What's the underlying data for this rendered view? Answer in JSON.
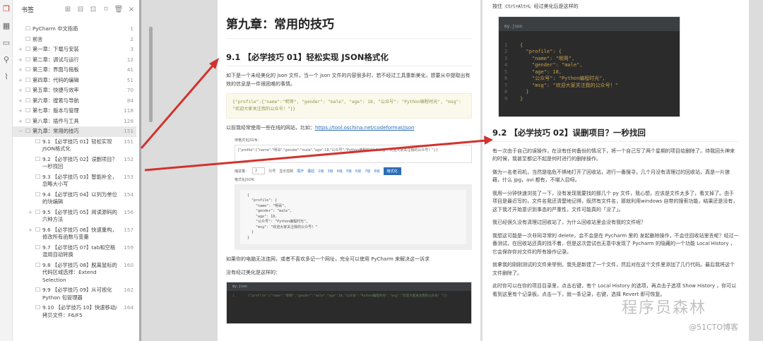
{
  "sidebar_icons": [
    "bookmark-icon",
    "thumbnails-icon",
    "comment-icon",
    "search-icon",
    "attachment-icon"
  ],
  "panel": {
    "title": "书签",
    "close": "×",
    "items": [
      {
        "label": "PyCharm 中文指南",
        "page": "1",
        "exp": ""
      },
      {
        "label": "前言",
        "page": "2",
        "exp": ""
      },
      {
        "label": "第一章：下载与安装",
        "page": "3",
        "exp": "+"
      },
      {
        "label": "第二章：调试与运行",
        "page": "12",
        "exp": "+"
      },
      {
        "label": "第三章：界面与拖板",
        "page": "41",
        "exp": "+"
      },
      {
        "label": "第四章：代码的编辑",
        "page": "51",
        "exp": "+"
      },
      {
        "label": "第五章：快捷与效率",
        "page": "70",
        "exp": "+"
      },
      {
        "label": "第六章：搜索与导航",
        "page": "84",
        "exp": "+"
      },
      {
        "label": "第七章：版本与管理",
        "page": "118",
        "exp": "+"
      },
      {
        "label": "第八章：插件与工具",
        "page": "128",
        "exp": "+"
      },
      {
        "label": "第九章：常用的技巧",
        "page": "151",
        "exp": "−"
      }
    ],
    "subitems": [
      {
        "label": "9.1 【必学技巧 01】轻松实现 JSON格式化",
        "page": "151",
        "exp": ""
      },
      {
        "label": "9.2 【必学技巧 02】误删项目？一秒找回",
        "page": "152",
        "exp": ""
      },
      {
        "label": "9.3 【必学技巧 03】智能补全，忽略大小写",
        "page": "153",
        "exp": ""
      },
      {
        "label": "9.4 【必学技巧 04】以列为单位的块编辑",
        "page": "154",
        "exp": ""
      },
      {
        "label": "9.5 【必学技巧 05】阅读源码的六种方法",
        "page": "156",
        "exp": "+"
      },
      {
        "label": "9.6 【必学技巧 06】快速重构，修改所有函数与变量",
        "page": "157",
        "exp": "+"
      },
      {
        "label": "9.7 【必学技巧 07】tab和空格混用自动转换",
        "page": "159",
        "exp": ""
      },
      {
        "label": "9.8 【必学技巧 08】脱离鼠标的代码区域选择：Extend Selection",
        "page": "160",
        "exp": ""
      },
      {
        "label": "9.9 【必学技巧 09】从可视化 Python 包管理器",
        "page": "162",
        "exp": ""
      },
      {
        "label": "9.10 【必学技巧 10】快速移动/拷贝文件：F6/F5",
        "page": "164",
        "exp": ""
      }
    ]
  },
  "page1": {
    "chapter": "第九章：常用的技巧",
    "h91": "9.1 【必学技巧 01】轻松实现 JSON格式化",
    "p1": "如下是一个未经美化的 json 文件，当一个 json 文件的内容很多时，若不经过工具重新美化，想要从中提取出有效的信息是一件很困难的事情。",
    "code": "{\"profile\":{\"name\":\"明哥\", \"gender\": \"male\", \"age\": 18, \"公众号\": \"Python编程时光\", \"msg\": \"欢迎大家关注我的公众号！\"}}",
    "p2": "以前我经常使用一些在线的网站，比如：",
    "link": "https://tool.oschina.net/codeformat/json",
    "tool": {
      "input_label": "待格式化JSON：",
      "input": "{\"profile\":{\"name\":\"明哥\",\"gender\":\"male\",\"age\":18,\"公众号\":\"Python编程时光\",\"msg\":\"欢迎大家关注我的公众号！\"}}",
      "indent_label": "缩进量：",
      "indent": "2",
      "quote": "引号",
      "show": "显示控制",
      "links": [
        "展开",
        "叠起",
        "2级",
        "3级",
        "4级",
        "5级",
        "6级",
        "7级",
        "8级"
      ],
      "button": "格式化",
      "output_label": "格式化JSON：",
      "out": [
        "{",
        "  \"profile\": {",
        "    \"name\": \"明哥\",",
        "    \"gender\": \"male\",",
        "    \"age\": 18,",
        "    \"公众号\": \"Python编程时光\",",
        "    \"msg\": \"欢迎大家关注我的公众号！\"",
        "  }",
        "}"
      ]
    },
    "p3": "如果你的电脑无法连网，或者不喜欢多记一个网址，完全可以使用 PyCharm 来解决这一诉求",
    "p4": "没有经过美化是这样的：",
    "ide_tab": "my.json",
    "ide_line": "{\"profile\":{\"name\":\"明哥\",\"gender\":\"male\",\"age\":18,\"公众号\":\"Python编程时光\",\"msg\":\"欢迎大家关注我的公众号！\"}}"
  },
  "page2": {
    "pre": "按住",
    "kbd": "Ctrl+Alt+L",
    "post": "经过美化后是这样的",
    "ide_tab": "my.json",
    "ide_lines": [
      "{",
      "  \"profile\": {",
      "    \"name\": \"明哥\",",
      "    \"gender\": \"male\",",
      "    \"age\": 18,",
      "    \"公众号\": \"Python编程时光\",",
      "    \"msg\": \"欢迎大家关注我的公众号！\"",
      "  }",
      "}"
    ],
    "h92": "9.2 【必学技巧 02】误删项目？一秒找回",
    "paras": [
      "有一次由于自己的误操作，在没有任何备份的情况下，将一个自己写了两个星期的项目给删除了。待我回头神来的时候，我甚至都记不起是何时进行的删除操作。",
      "做为一名老司机，当然是临危不惧地打开了回收站，进行一番搜寻，几个月没有清理过的回收站，真是一片狼藉，什么 jpg，avi 都有，不堪入目呀。",
      "我用一分钟快速浏览了一下，没有发现我要找的那几个 py 文件，我心想，应该是文件太多了，看叉掉了。由于项目是最近写的，文件名我还清楚地记得，既然有文件名，那就利用windows 自带的搜索功能，结果还是没有，这下我才开始意识到事态的严重性，文件可能真的「没了」。",
      "我已经很久没有清理过回收站了，为什么回收站里会没有我的文件呢？",
      "我想这可能是一次非同寻常的 delete，会不会是在 Pycharm 里的 发起删除操作，不会往回收站里丢呢？经过一番测试，在回收站还真的找不着，但是这次尝试也无意中发现了 Pycharm 的隐藏的一个功能 Local History ，它会保存你对文件的所有操作记录。",
      "就拿我的刚刚测试的文件来举例，我先是新建了一个文件，然后对在这个文件里添加了几行代码。最后我将这个文件删除了。",
      "此时你可以在你的项目目录里，点击右键，有个 Local History 的选项，再点击子选项 Show History ，你可以看到这里有个记录板。点击一下，就一条记录，右键，选择 Revert 即可恢复。"
    ]
  },
  "watermark": "程序员森林",
  "watermark2": "@51CTO博客"
}
